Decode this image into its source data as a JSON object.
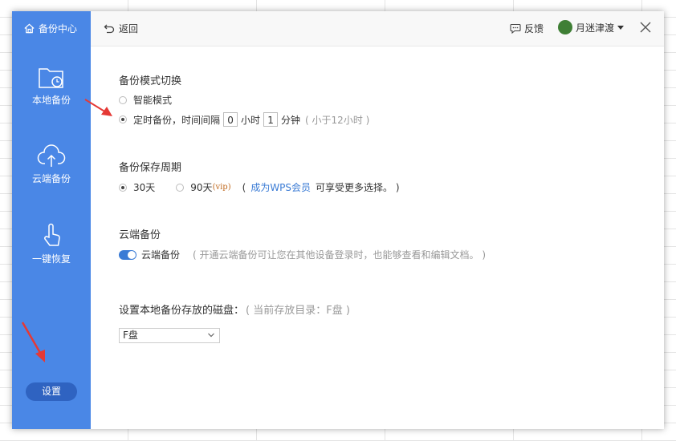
{
  "sidebar": {
    "brand": "备份中心",
    "items": [
      {
        "label": "本地备份",
        "icon": "folder-clock-icon"
      },
      {
        "label": "云端备份",
        "icon": "cloud-upload-icon"
      },
      {
        "label": "一键恢复",
        "icon": "hand-pointer-icon"
      }
    ],
    "settings_label": "设置"
  },
  "topbar": {
    "back_label": "返回",
    "feedback_label": "反馈",
    "user_name": "月迷津渡"
  },
  "mode": {
    "title": "备份模式切换",
    "smart_label": "智能模式",
    "timed_label": "定时备份，时间间隔",
    "hours_value": "0",
    "hours_unit": "小时",
    "minutes_value": "1",
    "minutes_unit": "分钟",
    "hint": "( 小于12小时 )"
  },
  "retention": {
    "title": "备份保存周期",
    "opt30": "30天",
    "opt90": "90天",
    "vip": "(vip)",
    "paren_open": "(",
    "link": "成为WPS会员",
    "tail": "可享受更多选择。 )"
  },
  "cloud": {
    "title": "云端备份",
    "toggle_label": "云端备份",
    "hint": "( 开通云端备份可让您在其他设备登录时，也能够查看和编辑文档。 )",
    "enabled": true
  },
  "disk": {
    "title": "设置本地备份存放的磁盘：",
    "current": "( 当前存放目录：F盘 )",
    "selected": "F盘"
  },
  "colors": {
    "sidebar": "#4a87e6",
    "accent": "#3a7bd5",
    "annotation": "#e53935"
  }
}
